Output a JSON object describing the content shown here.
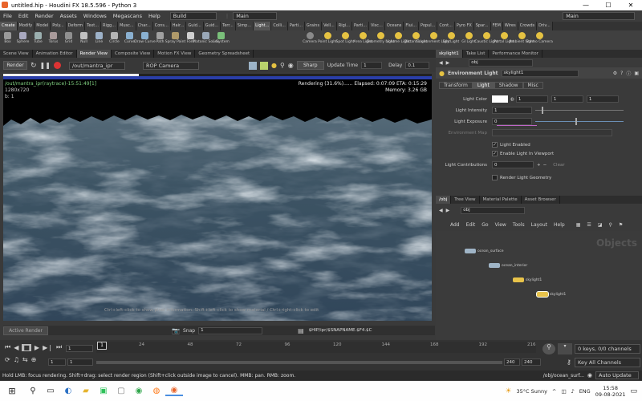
{
  "window": {
    "title": "untitled.hip - Houdini FX 18.5.596 - Python 3",
    "min": "—",
    "max": "☐",
    "close": "✕"
  },
  "menu": {
    "items": [
      "File",
      "Edit",
      "Render",
      "Assets",
      "Windows",
      "Megascans",
      "Help"
    ],
    "desktop": "Build",
    "desktop2": "Main",
    "right_desktop": "Main"
  },
  "shelf_tabs_left": [
    "Create",
    "Modify",
    "Model",
    "Poly...",
    "Deform",
    "Text...",
    "Rigg...",
    "Musc...",
    "Char...",
    "Cons...",
    "Hair...",
    "Guid...",
    "Guid...",
    "Terr...",
    "Simp..."
  ],
  "shelf_tabs_right": [
    "Light...",
    "Colli...",
    "Parti...",
    "Grains",
    "Vell...",
    "Rigi...",
    "Parti...",
    "Visc...",
    "Oceans",
    "Flui...",
    "Popul...",
    "Cont...",
    "Pyro FX",
    "Spar...",
    "FEM",
    "Wires",
    "Crowds",
    "Driv..."
  ],
  "tools_left": [
    "Box",
    "Sphere",
    "Tube",
    "Torus",
    "Grid",
    "Null",
    "Line",
    "Circle",
    "Curve",
    "Draw Curve",
    "Path",
    "Spray Paint",
    "Font",
    "Platonic Solids",
    "L-System"
  ],
  "tools_right": [
    "Camera",
    "Point Light",
    "Spot Light",
    "Area Light",
    "Geometry Light",
    "Volume Light",
    "Distant Light",
    "Environment Light",
    "Sky Light",
    "GI Light",
    "Caustic Light",
    "Portal Light",
    "Ambient Light",
    "Stereo Camera"
  ],
  "left_tabs": [
    "Scene View",
    "Animation Editor",
    "Render View",
    "Composite View",
    "Motion FX View",
    "Geometry Spreadsheet"
  ],
  "render_toolbar": {
    "render": "Render",
    "path": "/out/mantra_ipr",
    "rop": "ROP Camera",
    "sharp": "Sharp",
    "update_label": "Update Time",
    "update_val": "1",
    "delay_label": "Delay",
    "delay_val": "0.1"
  },
  "viewport": {
    "info_line1": "/out/mantra_ipr(raytrace)-15:51:49[1]",
    "info_line2": "1280x720",
    "info_line3": "b: 1",
    "status1": "Rendering (31.6%)......  Elapsed: 0:07:09   ETA: 0:15:29",
    "status2": "Memory:        3.26 GB",
    "hint": "Ctrl+left-click to show pixel information. Shift+left-click to show material / Ctrl+right-click to edit"
  },
  "vp_bottom": {
    "active": "Active Render",
    "snap": "Snap",
    "snap_val": "1",
    "path": "$HIP/ipr/$SNAPNAME.$F4.$C"
  },
  "right_top_tabs": [
    "skylight1",
    "Take List",
    "Performance Monitor"
  ],
  "param": {
    "path": "obj",
    "node_type": "Environment Light",
    "node_name": "skylight1",
    "subtabs": [
      "Transform",
      "Light",
      "Shadow",
      "Misc"
    ],
    "light_color_label": "Light Color",
    "color": [
      "1",
      "1",
      "1"
    ],
    "intensity_label": "Light Intensity",
    "intensity": "1",
    "exposure_label": "Light Exposure",
    "exposure": "0",
    "envmap_label": "Environment Map",
    "enabled": "Light Enabled",
    "enable_vp": "Enable Light In Viewport",
    "contrib_label": "Light Contributions",
    "contrib": "0",
    "clear": "Clear",
    "render_geo": "Render Light Geometry"
  },
  "right_bottom_tabs": [
    "/obj",
    "Tree View",
    "Material Palette",
    "Asset Browser"
  ],
  "network": {
    "path": "obj",
    "menu": [
      "Add",
      "Edit",
      "Go",
      "View",
      "Tools",
      "Layout",
      "Help"
    ],
    "title": "Objects",
    "nodes": [
      "ocean_surface",
      "ocean_interior",
      "skylight1",
      "skylight1"
    ]
  },
  "timeline": {
    "frame": "1",
    "ticks": [
      "24",
      "48",
      "72",
      "96",
      "120",
      "144",
      "168",
      "192",
      "216"
    ],
    "start": "1",
    "start2": "1",
    "end": "240",
    "end2": "240",
    "keys": "0 keys, 0/0 channels",
    "keyall": "Key All Channels",
    "auto": "Auto Update",
    "objpath": "/obj/ocean_surf..."
  },
  "statusline": "Hold LMB: focus rendering. Shift+drag: select render region (Shift+click outside image to cancel). MMB: pan. RMB: zoom.",
  "taskbar": {
    "weather": "35°C  Sunny",
    "lang": "ENG",
    "time": "15:58",
    "date": "09-08-2021"
  }
}
